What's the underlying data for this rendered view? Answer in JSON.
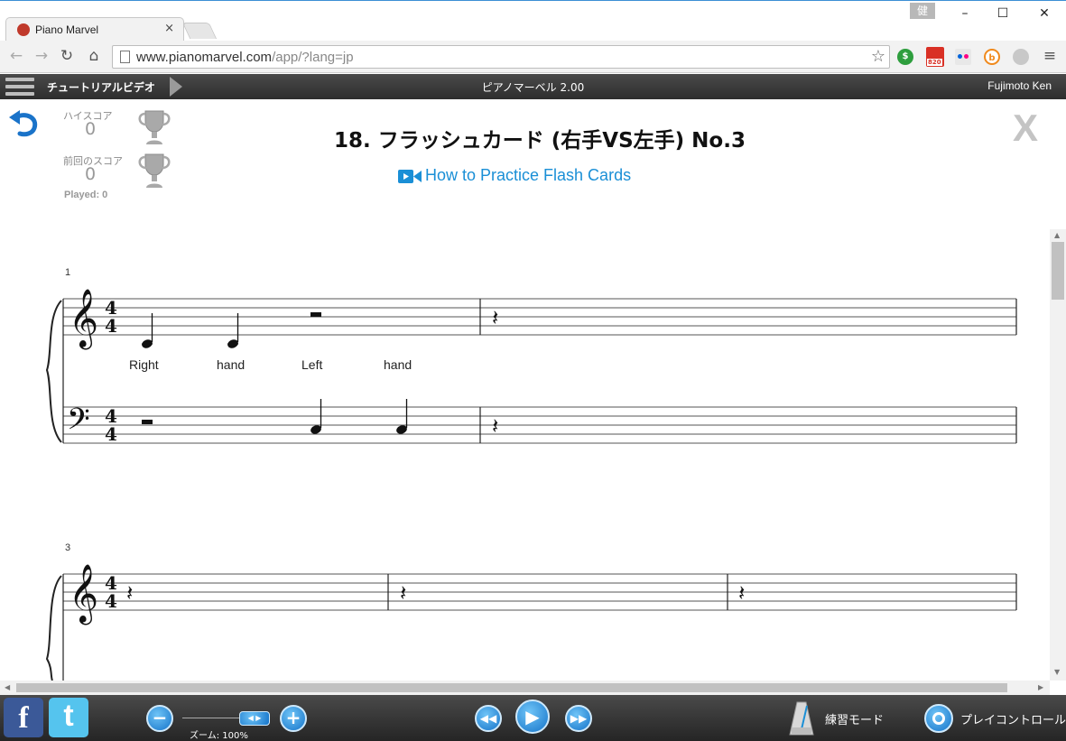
{
  "browser": {
    "tab_title": "Piano Marvel",
    "tab_close": "×",
    "window_user_badge": "健",
    "window_minimize": "–",
    "window_maximize": "☐",
    "window_close": "✕",
    "url_host": "www.pianomarvel.com",
    "url_path": "/app/?lang=jp",
    "ext_badge": "820"
  },
  "appbar": {
    "tutorial_label": "チュートリアルビデオ",
    "title": "ピアノマーベル 2.00",
    "user": "Fujimoto Ken"
  },
  "scores": {
    "high_label": "ハイスコア",
    "high_value": "0",
    "prev_label": "前回のスコア",
    "prev_value": "0",
    "played": "Played: 0"
  },
  "lesson": {
    "title": "18. フラッシュカード (右手VS左手) No.3",
    "video_link": "How to Practice Flash Cards",
    "close": "X"
  },
  "score_sheet": {
    "system1_measure_number": "1",
    "system2_measure_number": "3",
    "time_signature": [
      "4",
      "4"
    ],
    "lyrics": [
      "Right",
      "hand",
      "Left",
      "hand"
    ]
  },
  "toolbar": {
    "zoom_label": "ズーム: 100%",
    "practice_mode": "練習モード",
    "play_control": "プレイコントロール",
    "facebook": "f",
    "twitter": "t"
  },
  "colors": {
    "accent_blue": "#1a8fd6",
    "bar_dark": "#2e2e2e"
  }
}
